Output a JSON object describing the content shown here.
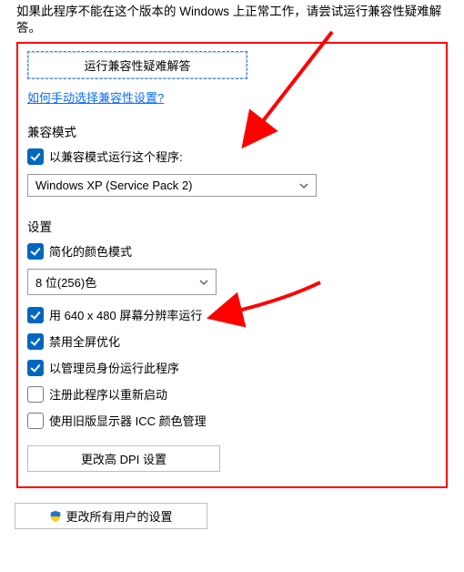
{
  "intro": "如果此程序不能在这个版本的 Windows 上正常工作，请尝试运行兼容性疑难解答。",
  "buttons": {
    "troubleshoot": "运行兼容性疑难解答",
    "high_dpi": "更改高 DPI 设置",
    "all_users": "更改所有用户的设置"
  },
  "link_text": "如何手动选择兼容性设置?",
  "compat_mode": {
    "title": "兼容模式",
    "checkbox_label": "以兼容模式运行这个程序:",
    "select_value": "Windows XP (Service Pack 2)"
  },
  "settings": {
    "title": "设置",
    "reduced_color_label": "简化的颜色模式",
    "color_select_value": "8 位(256)色",
    "res_label": "用 640 x 480 屏幕分辨率运行",
    "disable_fullscreen_label": "禁用全屏优化",
    "run_admin_label": "以管理员身份运行此程序",
    "register_restart_label": "注册此程序以重新启动",
    "legacy_icc_label": "使用旧版显示器 ICC 颜色管理"
  }
}
